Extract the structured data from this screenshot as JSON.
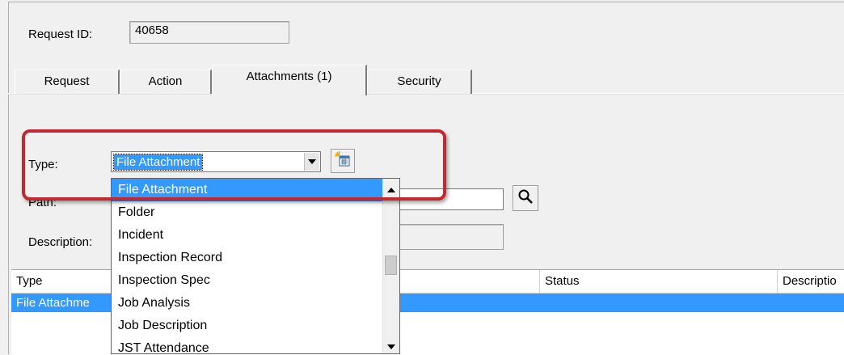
{
  "request": {
    "id_label": "Request ID:",
    "id_value": "40658"
  },
  "tabs": [
    {
      "label": "Request"
    },
    {
      "label": "Action"
    },
    {
      "label": "Attachments (1)"
    },
    {
      "label": "Security"
    }
  ],
  "form": {
    "type_label": "Type:",
    "type_value": "File Attachment",
    "path_label": "Path:",
    "description_label": "Description:"
  },
  "dropdown": {
    "options": [
      "File Attachment",
      "Folder",
      "Incident",
      "Inspection Record",
      "Inspection Spec",
      "Job Analysis",
      "Job Description",
      "JST Attendance"
    ],
    "selected_index": 0
  },
  "grid": {
    "columns": [
      "Type",
      "Status",
      "Descriptio"
    ],
    "rows": [
      {
        "type": "File Attachme"
      }
    ]
  },
  "colors": {
    "selection": "#3399ff",
    "highlight_border": "#c3272f"
  },
  "icons": [
    "new-attachment-icon",
    "search-icon",
    "chevron-down-icon",
    "chevron-up-icon"
  ]
}
